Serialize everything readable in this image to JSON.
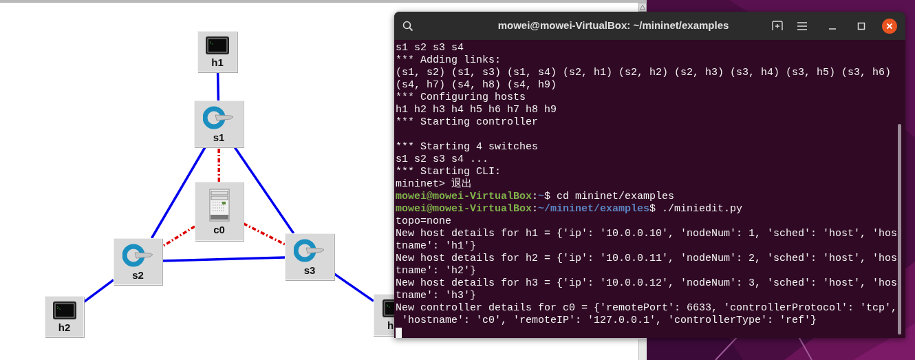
{
  "canvas": {
    "nodes": [
      {
        "kind": "host",
        "label": "h1"
      },
      {
        "kind": "switch",
        "label": "s1"
      },
      {
        "kind": "controller",
        "label": "c0"
      },
      {
        "kind": "switch",
        "label": "s2"
      },
      {
        "kind": "switch",
        "label": "s3"
      },
      {
        "kind": "host",
        "label": "h2"
      },
      {
        "kind": "host",
        "label": "h"
      }
    ],
    "links": [
      {
        "kind": "data"
      },
      {
        "kind": "data"
      },
      {
        "kind": "data"
      },
      {
        "kind": "data"
      },
      {
        "kind": "data"
      },
      {
        "kind": "data"
      },
      {
        "kind": "control"
      },
      {
        "kind": "control"
      },
      {
        "kind": "control"
      }
    ]
  },
  "terminal": {
    "title": "mowei@mowei-VirtualBox: ~/mininet/examples",
    "lines": [
      {
        "segments": [
          {
            "kind": "plain",
            "text": "s1 s2 s3 s4"
          }
        ]
      },
      {
        "segments": [
          {
            "kind": "plain",
            "text": "*** Adding links:"
          }
        ]
      },
      {
        "segments": [
          {
            "kind": "plain",
            "text": "(s1, s2) (s1, s3) (s1, s4) (s2, h1) (s2, h2) (s2, h3) (s3, h4) (s3, h5) (s3, h6)"
          }
        ]
      },
      {
        "segments": [
          {
            "kind": "plain",
            "text": "(s4, h7) (s4, h8) (s4, h9)"
          }
        ]
      },
      {
        "segments": [
          {
            "kind": "plain",
            "text": "*** Configuring hosts"
          }
        ]
      },
      {
        "segments": [
          {
            "kind": "plain",
            "text": "h1 h2 h3 h4 h5 h6 h7 h8 h9"
          }
        ]
      },
      {
        "segments": [
          {
            "kind": "plain",
            "text": "*** Starting controller"
          }
        ]
      },
      {
        "segments": [
          {
            "kind": "plain",
            "text": "*** Starting 4 switches"
          }
        ]
      },
      {
        "segments": [
          {
            "kind": "plain",
            "text": "s1 s2 s3 s4 ..."
          }
        ]
      },
      {
        "segments": [
          {
            "kind": "plain",
            "text": "*** Starting CLI:"
          }
        ]
      },
      {
        "segments": [
          {
            "kind": "plain",
            "text": "mininet> 退出"
          }
        ]
      },
      {
        "segments": [
          {
            "kind": "user",
            "text": "mowei@mowei-VirtualBox"
          },
          {
            "kind": "plain",
            "text": ":"
          },
          {
            "kind": "path",
            "text": "~"
          },
          {
            "kind": "plain",
            "text": "$ cd mininet/examples"
          }
        ]
      },
      {
        "segments": [
          {
            "kind": "user",
            "text": "mowei@mowei-VirtualBox"
          },
          {
            "kind": "plain",
            "text": ":"
          },
          {
            "kind": "path",
            "text": "~/mininet/examples"
          },
          {
            "kind": "plain",
            "text": "$ ./miniedit.py"
          }
        ]
      },
      {
        "segments": [
          {
            "kind": "plain",
            "text": "topo=none"
          }
        ]
      },
      {
        "segments": [
          {
            "kind": "plain",
            "text": "New host details for h1 = {'ip': '10.0.0.10', 'nodeNum': 1, 'sched': 'host', 'hos"
          }
        ]
      },
      {
        "segments": [
          {
            "kind": "plain",
            "text": "tname': 'h1'}"
          }
        ]
      },
      {
        "segments": [
          {
            "kind": "plain",
            "text": "New host details for h2 = {'ip': '10.0.0.11', 'nodeNum': 2, 'sched': 'host', 'hos"
          }
        ]
      },
      {
        "segments": [
          {
            "kind": "plain",
            "text": "tname': 'h2'}"
          }
        ]
      },
      {
        "segments": [
          {
            "kind": "plain",
            "text": "New host details for h3 = {'ip': '10.0.0.12', 'nodeNum': 3, 'sched': 'host', 'hos"
          }
        ]
      },
      {
        "segments": [
          {
            "kind": "plain",
            "text": "tname': 'h3'}"
          }
        ]
      },
      {
        "segments": [
          {
            "kind": "plain",
            "text": "New controller details for c0 = {'remotePort': 6633, 'controllerProtocol': 'tcp',"
          }
        ]
      },
      {
        "segments": [
          {
            "kind": "plain",
            "text": " 'hostname': 'c0', 'remoteIP': '127.0.0.1', 'controllerType': 'ref'}"
          }
        ]
      }
    ]
  }
}
